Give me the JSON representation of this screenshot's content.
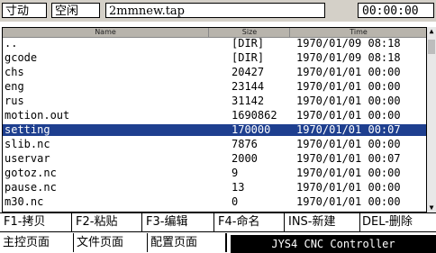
{
  "status_bar": {
    "mode": "寸动",
    "state": "空闲",
    "file": "2mmnew.tap",
    "timer": "00:00:00"
  },
  "file_list": {
    "columns": {
      "name": "Name",
      "size": "Size",
      "time": "Time"
    },
    "rows": [
      {
        "name": "..",
        "size": "[DIR]",
        "time": "1970/01/09  08:18"
      },
      {
        "name": "gcode",
        "size": "[DIR]",
        "time": "1970/01/09  08:18"
      },
      {
        "name": "chs",
        "size": "20427",
        "time": "1970/01/01  00:00"
      },
      {
        "name": "eng",
        "size": "23144",
        "time": "1970/01/01  00:00"
      },
      {
        "name": "rus",
        "size": "31142",
        "time": "1970/01/01  00:00"
      },
      {
        "name": "motion.out",
        "size": "1690862",
        "time": "1970/01/01  00:00"
      },
      {
        "name": "setting",
        "size": "170000",
        "time": "1970/01/01  00:07",
        "selected": true
      },
      {
        "name": "slib.nc",
        "size": "7876",
        "time": "1970/01/01  00:00"
      },
      {
        "name": "uservar",
        "size": "2000",
        "time": "1970/01/01  00:07"
      },
      {
        "name": "gotoz.nc",
        "size": "9",
        "time": "1970/01/01  00:00"
      },
      {
        "name": "pause.nc",
        "size": "13",
        "time": "1970/01/01  00:00"
      },
      {
        "name": "m30.nc",
        "size": "0",
        "time": "1970/01/01  00:00"
      }
    ],
    "selected_color": "#1e3f8f"
  },
  "function_keys": [
    {
      "label": "F1-拷贝"
    },
    {
      "label": "F2-粘贴"
    },
    {
      "label": "F3-编辑"
    },
    {
      "label": "F4-命名"
    },
    {
      "label": "INS-新建"
    },
    {
      "label": "DEL-删除"
    }
  ],
  "page_tabs": [
    {
      "label": "主控页面"
    },
    {
      "label": "文件页面"
    },
    {
      "label": "配置页面"
    }
  ],
  "controller_title": "JYS4 CNC Controller"
}
